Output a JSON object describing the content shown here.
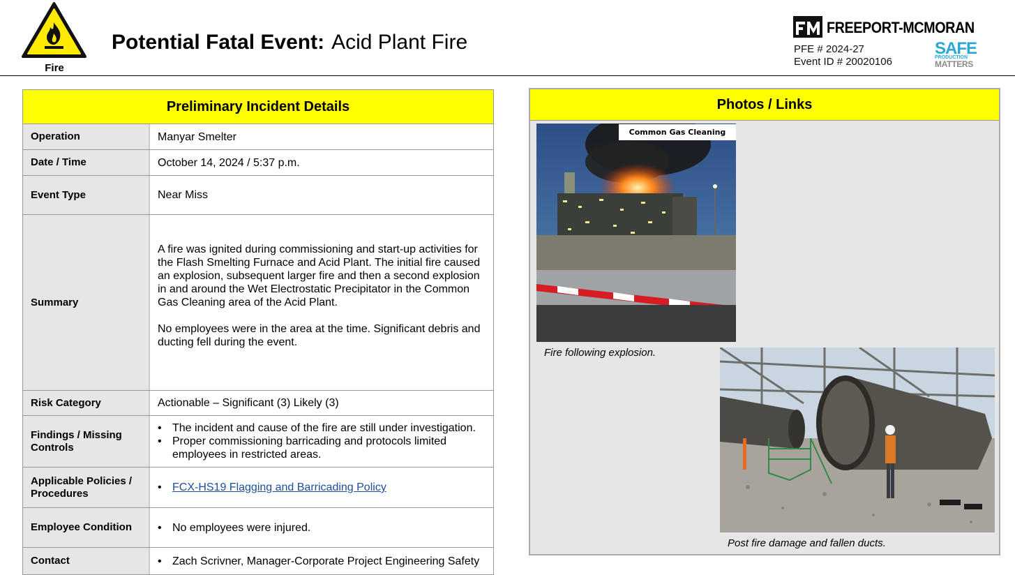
{
  "header": {
    "hazard_label": "Fire",
    "title_bold": "Potential Fatal Event:",
    "title_text": "Acid Plant Fire",
    "company": "FREEPORT-MCMORAN",
    "pfe": "PFE # 2024-27",
    "event_id": "Event ID # 20020106",
    "safe_line1": "SAFE",
    "safe_line2": "PRODUCTION",
    "safe_line3": "MATTERS"
  },
  "details": {
    "heading": "Preliminary Incident Details",
    "operation_label": "Operation",
    "operation": "Manyar Smelter",
    "datetime_label": "Date / Time",
    "datetime": "October 14, 2024 / 5:37 p.m.",
    "event_type_label": "Event Type",
    "event_type": "Near Miss",
    "summary_label": "Summary",
    "summary_p1": "A fire was ignited during commissioning and start-up activities for the Flash Smelting Furnace and Acid Plant. The initial fire caused an explosion, subsequent larger fire and then a second explosion in and around the Wet Electrostatic Precipitator in the Common Gas Cleaning area of the Acid Plant.",
    "summary_p2": "No employees were in the area at the time. Significant debris and ducting fell during the event.",
    "risk_label": "Risk Category",
    "risk": "Actionable – Significant (3) Likely (3)",
    "findings_label": "Findings / Missing Controls",
    "findings": [
      "The incident and cause of the fire are still under investigation.",
      "Proper commissioning barricading and protocols limited employees in restricted areas."
    ],
    "policies_label": "Applicable Policies / Procedures",
    "policy": "FCX-HS19 Flagging and Barricading Policy",
    "condition_label": "Employee Condition",
    "condition": "No employees were injured.",
    "contact_label": "Contact",
    "contact": "Zach Scrivner, Manager-Corporate Project Engineering Safety"
  },
  "photos": {
    "heading": "Photos / Links",
    "photo1_tag": "Common Gas Cleaning",
    "caption1": "Fire following explosion.",
    "caption2": "Post fire damage and fallen ducts."
  },
  "colors": {
    "header_band": "#ffff00",
    "label_bg": "#e6e6e6",
    "link": "#1f4e9c",
    "safe_blue": "#29a8d8"
  }
}
